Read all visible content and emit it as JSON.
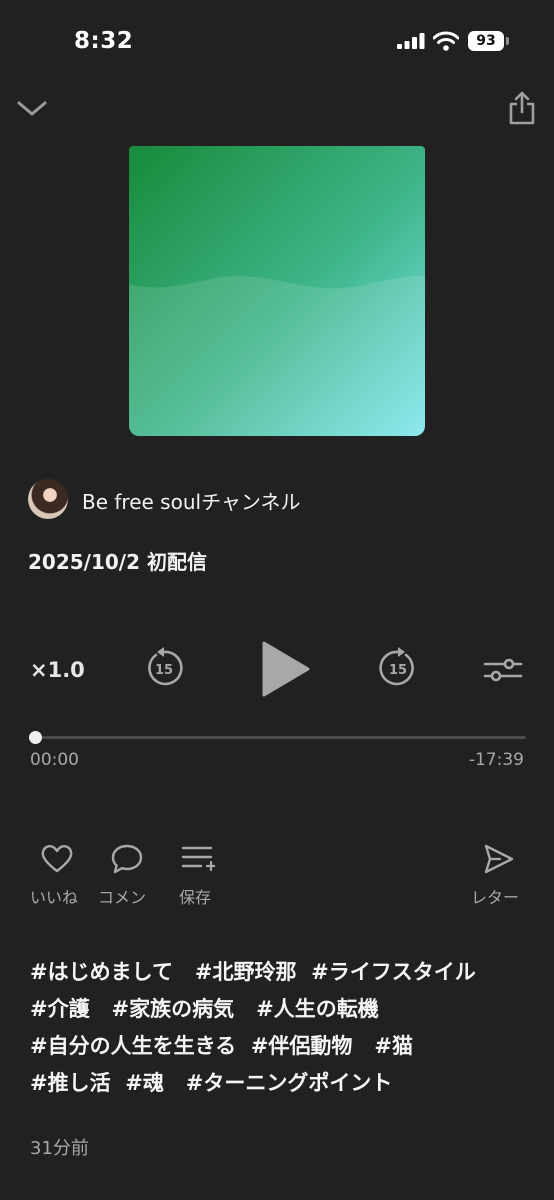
{
  "status_bar": {
    "time": "8:32",
    "battery": "93"
  },
  "episode": {
    "channel_name": "Be free soulチャンネル",
    "release": "2025/10/2 初配信",
    "posted_ago": "31分前"
  },
  "player": {
    "speed": "×1.0",
    "skip_back_seconds": "15",
    "skip_forward_seconds": "15",
    "elapsed": "00:00",
    "remaining": "-17:39",
    "progress_fraction": 0.0
  },
  "actions": {
    "like_label": "いいね",
    "comment_label": "コメン",
    "save_label": "保存",
    "letter_label": "レター"
  },
  "hashtags": [
    [
      "#はじめまして",
      "#北野玲那",
      "#ライフスタイル"
    ],
    [
      "#介護",
      "#家族の病気",
      "#人生の転機"
    ],
    [
      "#自分の人生を生きる",
      "#伴侶動物",
      "#猫"
    ],
    [
      "#推し活",
      "#魂",
      "#ターニングポイント"
    ]
  ],
  "colors": {
    "background": "#212121",
    "art_top": "#188a3a",
    "art_bottom": "#7ee6ec",
    "secondary_text": "#a8a8a8"
  }
}
